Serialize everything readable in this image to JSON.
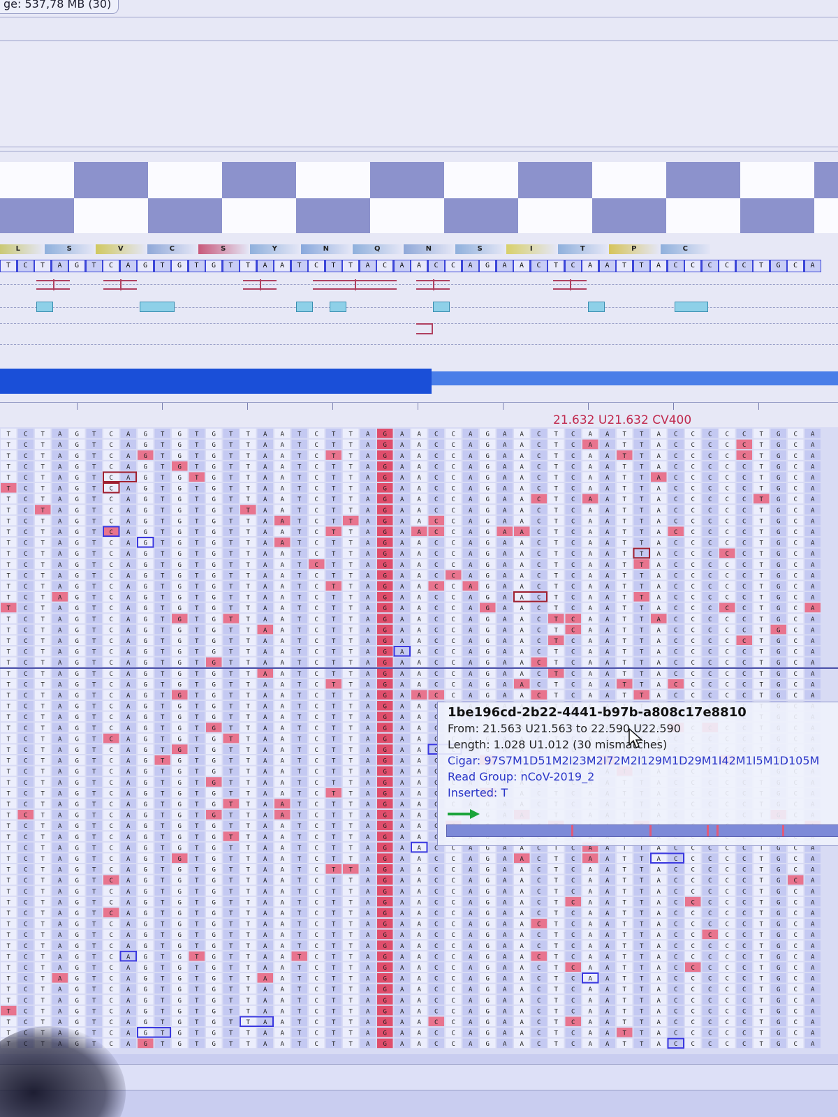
{
  "status": {
    "text": "ge: 537,78 MB (30)"
  },
  "amino_acids": [
    "L",
    "S",
    "V",
    "C",
    "S",
    "Y",
    "N",
    "Q",
    "N",
    "S",
    "I",
    "T",
    "P",
    "C"
  ],
  "reference": {
    "bases": [
      "T",
      "C",
      "T",
      "A",
      "G",
      "T",
      "C",
      "A",
      "G",
      "T",
      "G",
      "T",
      "G",
      "T",
      "T",
      "A",
      "A",
      "T",
      "C",
      "T",
      "T",
      "A",
      "C",
      "A",
      "A",
      "C",
      "C",
      "A",
      "G",
      "A",
      "A",
      "C",
      "T",
      "C",
      "A",
      "A",
      "T",
      "T",
      "A",
      "C",
      "C",
      "C",
      "C",
      "C",
      "T",
      "G",
      "C",
      "A"
    ]
  },
  "position_label": "21.632 U21.632 CV400",
  "tooltip": {
    "read_name": "1be196cd-2b22-4441-b97b-a808c17e8810",
    "range": "From: 21.563 U21.563 to 22.590 U22.590",
    "length": "Length: 1.028 U1.012 (30 mismatches)",
    "cigar": "Cigar: 97S7M1D51M2I23M2I72M2I129M1D29M1I42M1I5M1D105M",
    "read_group": "Read Group: nCoV-2019_2",
    "inserted": "Inserted: T"
  },
  "colors": {
    "reference_track": "#3c46d8",
    "mismatch": "#e8748e",
    "variant_column": "#e04e6c",
    "insertion_box": "#3a38e0",
    "deletion_box": "#a02030",
    "coverage": "#1a4fd8",
    "position_label": "#c02a4e"
  },
  "icons": [
    "mouse-cursor-icon",
    "green-arrow-icon"
  ]
}
